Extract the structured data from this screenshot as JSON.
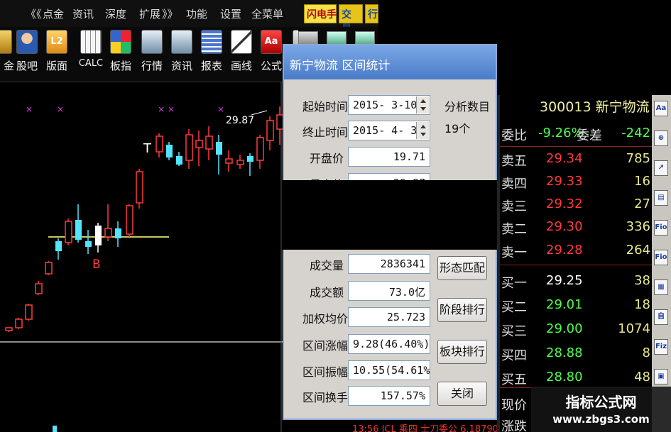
{
  "menu": {
    "items": [
      "《《",
      "点金",
      "资讯",
      "深度",
      "扩展",
      "》》",
      "功能",
      "设置",
      "全菜单"
    ],
    "flash_button": "闪电手",
    "trade_button": "交易",
    "trade_button2": "行"
  },
  "toolbar": {
    "items": [
      {
        "label": "金",
        "icon": "fund-icon"
      },
      {
        "label": "股吧",
        "icon": "community-icon"
      },
      {
        "label": "版面",
        "icon": "level2-icon"
      },
      {
        "label": "CALC",
        "icon": "calculator-icon"
      },
      {
        "label": "板指",
        "icon": "sector-index-icon"
      },
      {
        "label": "行情",
        "icon": "quote-icon"
      },
      {
        "label": "资讯",
        "icon": "news-icon"
      },
      {
        "label": "报表",
        "icon": "report-icon"
      },
      {
        "label": "画线",
        "icon": "draw-line-icon"
      },
      {
        "label": "公式",
        "icon": "formula-icon"
      }
    ],
    "l2_text": "L2",
    "aa_text": "Aa"
  },
  "chart": {
    "high_label": "29.87",
    "t_marker": "T",
    "b_marker": "B",
    "x_marker": "×",
    "colors": {
      "up": "#ff3b3b",
      "down": "#54e4ff",
      "baseline": "#c8c860",
      "marker": "#c846d6"
    }
  },
  "dialog": {
    "title": "新宁物流  区间统计",
    "fields": [
      {
        "label": "起始时间",
        "value": "2015- 3-10"
      },
      {
        "label": "终止时间",
        "value": "2015- 4- 3"
      },
      {
        "label": "开盘价",
        "value": "19.71"
      },
      {
        "label": "最高价",
        "value": "29.87"
      }
    ],
    "count_label": "分析数目",
    "count_value": "19个",
    "stats": [
      {
        "label": "成交量",
        "value": "2836341"
      },
      {
        "label": "成交额",
        "value": "73.0亿"
      },
      {
        "label": "加权均价",
        "value": "25.723"
      },
      {
        "label": "区间涨幅",
        "value": "9.28(46.40%)"
      },
      {
        "label": "区间振幅",
        "value": "10.55(54.61%)"
      },
      {
        "label": "区间换手",
        "value": "157.57%"
      }
    ],
    "buttons": {
      "pattern": "形态匹配",
      "stage": "阶段排行",
      "sector": "板块排行",
      "close": "关闭"
    }
  },
  "quote": {
    "code": "300013 新宁物流",
    "ratio_label": "委比",
    "ratio_value": "-9.26%",
    "diff_label": "委差",
    "diff_value": "-242",
    "rows": [
      {
        "label": "卖五",
        "price": "29.34",
        "vol": "785",
        "color": "#ff3b3b"
      },
      {
        "label": "卖四",
        "price": "29.33",
        "vol": "16",
        "color": "#ff3b3b"
      },
      {
        "label": "卖三",
        "price": "29.32",
        "vol": "27",
        "color": "#ff3b3b"
      },
      {
        "label": "卖二",
        "price": "29.30",
        "vol": "336",
        "color": "#ff3b3b"
      },
      {
        "label": "卖一",
        "price": "29.28",
        "vol": "264",
        "color": "#ff3b3b"
      },
      {
        "label": "买一",
        "price": "29.25",
        "vol": "38",
        "color": "#ffffff"
      },
      {
        "label": "买二",
        "price": "29.01",
        "vol": "18",
        "color": "#4cff4c"
      },
      {
        "label": "买三",
        "price": "29.00",
        "vol": "1074",
        "color": "#4cff4c"
      },
      {
        "label": "买四",
        "price": "28.88",
        "vol": "8",
        "color": "#4cff4c"
      },
      {
        "label": "买五",
        "price": "28.80",
        "vol": "48",
        "color": "#4cff4c"
      }
    ],
    "now_label": "现价",
    "bottom_partial": "涨跌"
  },
  "right_strip": [
    "Aa",
    "⊕",
    "↗",
    "▤",
    "Fio",
    "Fio",
    "▦",
    "自",
    "Fiz",
    "▣"
  ],
  "bottom_ticker": "13:56  ICL  乘四  士刀委公 6.18790",
  "watermark": {
    "line1": "指标公式网",
    "line2": "www.zbgs3.com"
  }
}
